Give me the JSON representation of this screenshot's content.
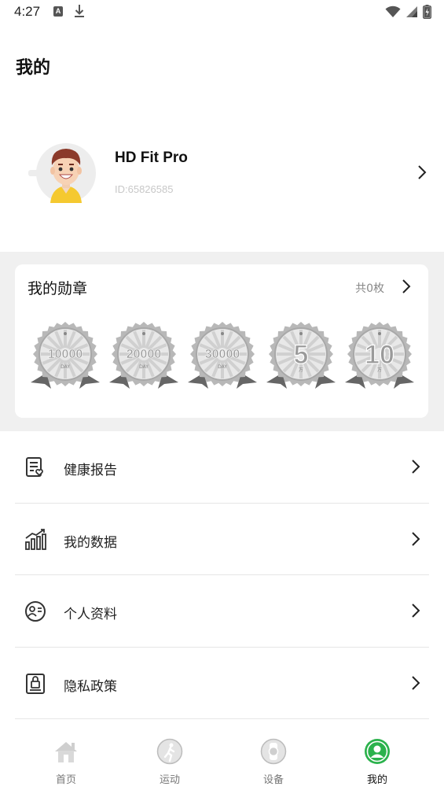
{
  "status_bar": {
    "time": "4:27",
    "notification_letter": "A"
  },
  "page": {
    "title": "我的"
  },
  "profile": {
    "name": "HD Fit Pro",
    "id_text": "ID:65826585"
  },
  "badges": {
    "title": "我的勋章",
    "count": "共0枚",
    "items": [
      {
        "value": "10000",
        "unit": "DAY"
      },
      {
        "value": "20000",
        "unit": "DAY"
      },
      {
        "value": "30000",
        "unit": "DAY"
      },
      {
        "value": "5",
        "unit": "万"
      },
      {
        "value": "10",
        "unit": "万"
      }
    ]
  },
  "menu": {
    "items": [
      {
        "label": "健康报告",
        "icon": "health-report-icon"
      },
      {
        "label": "我的数据",
        "icon": "data-chart-icon"
      },
      {
        "label": "个人资料",
        "icon": "profile-info-icon"
      },
      {
        "label": "隐私政策",
        "icon": "privacy-lock-icon"
      }
    ]
  },
  "tabs": [
    {
      "label": "首页",
      "icon": "home-icon"
    },
    {
      "label": "运动",
      "icon": "running-icon"
    },
    {
      "label": "设备",
      "icon": "watch-icon"
    },
    {
      "label": "我的",
      "icon": "user-icon",
      "active": true
    }
  ],
  "colors": {
    "accent": "#2bb24c",
    "background_band": "#f0f0f0",
    "badge_gray": "#b8b8b8"
  }
}
